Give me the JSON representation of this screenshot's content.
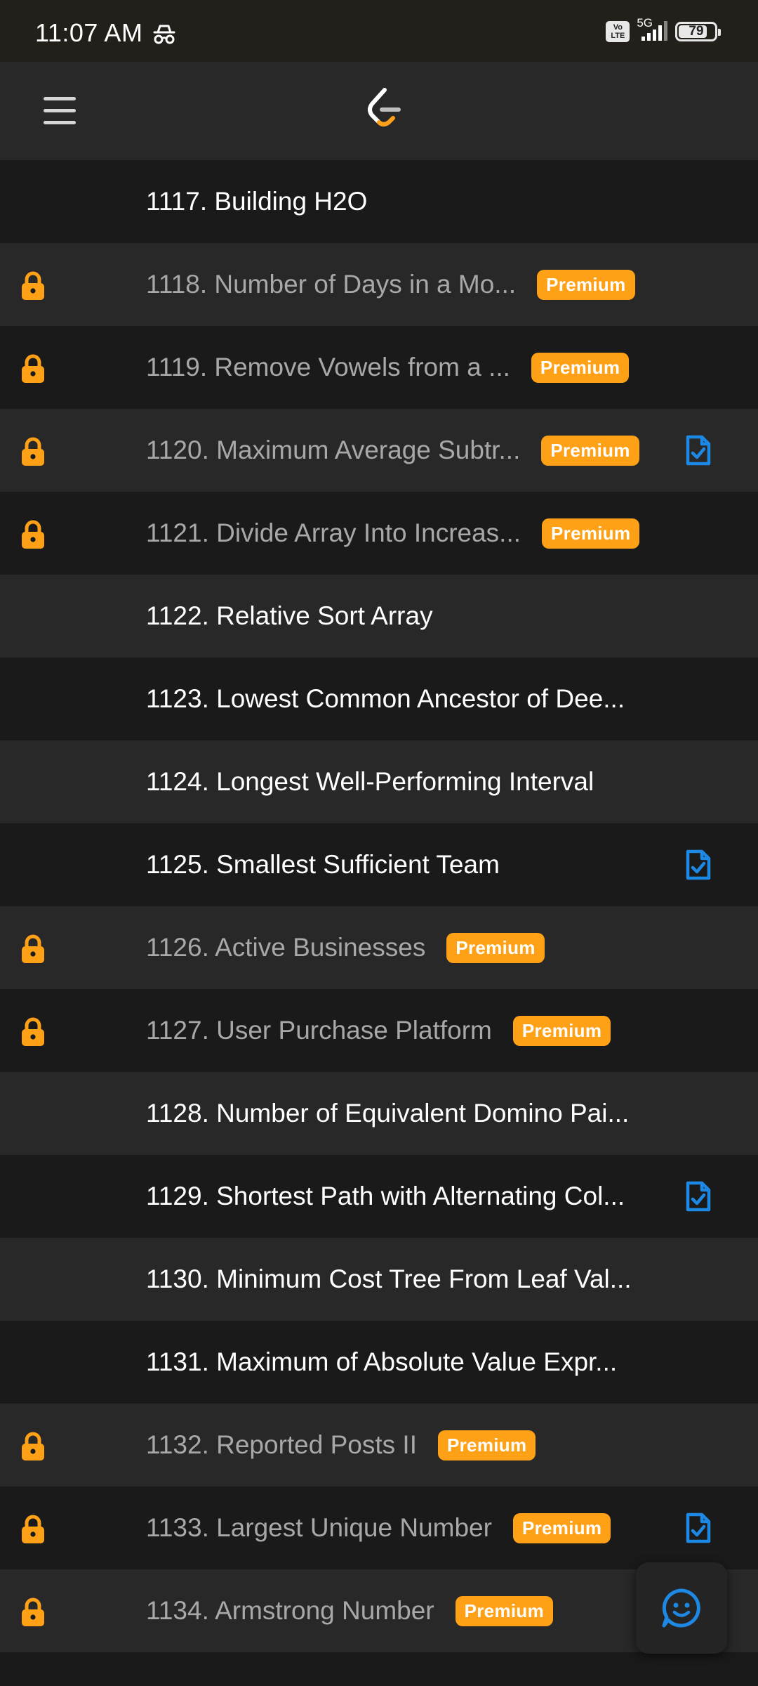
{
  "status_bar": {
    "time": "11:07 AM",
    "volte_top": "Vo",
    "volte_bottom": "LTE",
    "network": "5G",
    "battery": "79",
    "battery_level": 0.79
  },
  "app_bar": {
    "menu_icon": "hamburger-menu-icon",
    "logo_icon": "leetcode-logo"
  },
  "colors": {
    "accent": "#ffa116",
    "solution_icon": "#1e88e5",
    "row_dark": "#1a1a1a",
    "row_light": "#282828"
  },
  "problems": [
    {
      "title": "1117. Building H2O",
      "locked": false,
      "badge": "",
      "solution": false
    },
    {
      "title": "1118. Number of Days in a Mo...",
      "locked": true,
      "badge": "Premium",
      "solution": false
    },
    {
      "title": "1119. Remove Vowels from a ...",
      "locked": true,
      "badge": "Premium",
      "solution": false
    },
    {
      "title": "1120. Maximum Average Subtr...",
      "locked": true,
      "badge": "Premium",
      "solution": true
    },
    {
      "title": "1121. Divide Array Into Increas...",
      "locked": true,
      "badge": "Premium",
      "solution": false
    },
    {
      "title": "1122. Relative Sort Array",
      "locked": false,
      "badge": "",
      "solution": false
    },
    {
      "title": "1123. Lowest Common Ancestor of Dee...",
      "locked": false,
      "badge": "",
      "solution": false
    },
    {
      "title": "1124. Longest Well-Performing Interval",
      "locked": false,
      "badge": "",
      "solution": false
    },
    {
      "title": "1125. Smallest Sufficient Team",
      "locked": false,
      "badge": "",
      "solution": true
    },
    {
      "title": "1126. Active Businesses",
      "locked": true,
      "badge": "Premium",
      "solution": false
    },
    {
      "title": "1127. User Purchase Platform",
      "locked": true,
      "badge": "Premium",
      "solution": false
    },
    {
      "title": "1128. Number of Equivalent Domino Pai...",
      "locked": false,
      "badge": "",
      "solution": false
    },
    {
      "title": "1129. Shortest Path with Alternating Col...",
      "locked": false,
      "badge": "",
      "solution": true
    },
    {
      "title": "1130. Minimum Cost Tree From Leaf Val...",
      "locked": false,
      "badge": "",
      "solution": false
    },
    {
      "title": "1131. Maximum of Absolute Value Expr...",
      "locked": false,
      "badge": "",
      "solution": false
    },
    {
      "title": "1132. Reported Posts II",
      "locked": true,
      "badge": "Premium",
      "solution": false
    },
    {
      "title": "1133. Largest Unique Number",
      "locked": true,
      "badge": "Premium",
      "solution": true
    },
    {
      "title": "1134. Armstrong Number",
      "locked": true,
      "badge": "Premium",
      "solution": false
    }
  ],
  "fab": {
    "icon": "smiley-chat-icon"
  }
}
